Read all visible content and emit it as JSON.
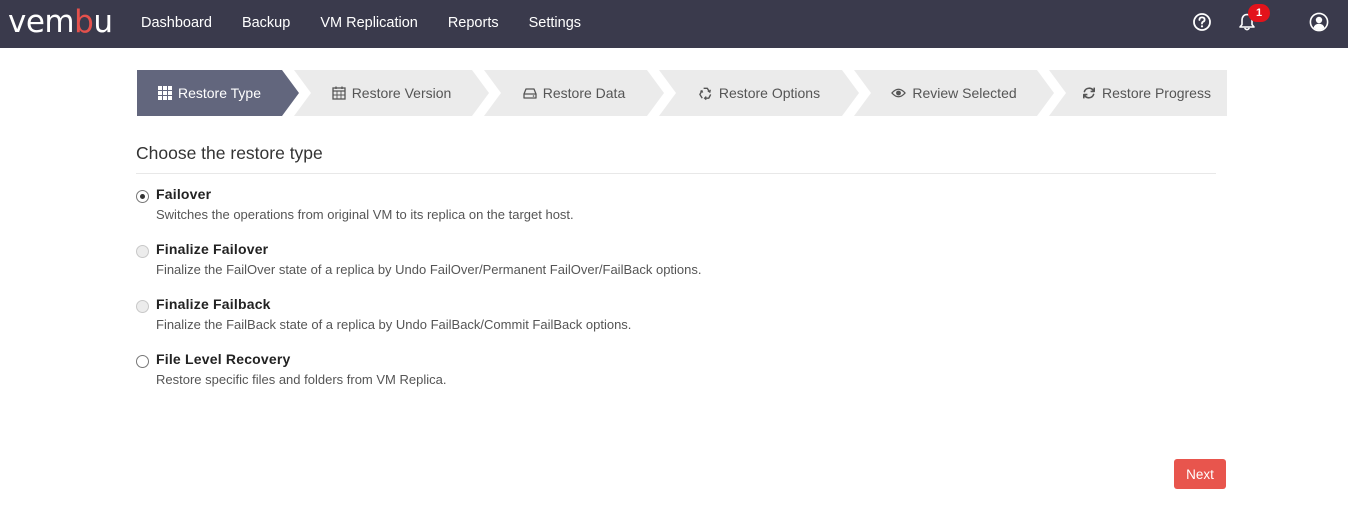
{
  "logo": {
    "text_main": "vem",
    "text_accent": "b",
    "text_end": "u"
  },
  "nav": [
    "Dashboard",
    "Backup",
    "VM Replication",
    "Reports",
    "Settings"
  ],
  "notifications": {
    "count": "1"
  },
  "steps": [
    {
      "label": "Restore Type",
      "icon": "grid-icon",
      "active": true
    },
    {
      "label": "Restore Version",
      "icon": "calendar-icon",
      "active": false
    },
    {
      "label": "Restore Data",
      "icon": "drive-icon",
      "active": false
    },
    {
      "label": "Restore Options",
      "icon": "recycle-icon",
      "active": false
    },
    {
      "label": "Review Selected",
      "icon": "eye-icon",
      "active": false
    },
    {
      "label": "Restore Progress",
      "icon": "refresh-icon",
      "active": false
    }
  ],
  "heading": "Choose the restore type",
  "options": [
    {
      "title": "Failover",
      "description": "Switches the operations from original VM to its replica on the target host.",
      "state": "checked"
    },
    {
      "title": "Finalize Failover",
      "description": "Finalize the FailOver state of a replica by Undo FailOver/Permanent FailOver/FailBack options.",
      "state": "disabled"
    },
    {
      "title": "Finalize Failback",
      "description": "Finalize the FailBack state of a replica by Undo FailBack/Commit FailBack options.",
      "state": "disabled"
    },
    {
      "title": "File Level Recovery",
      "description": "Restore specific files and folders from VM Replica.",
      "state": "unchecked"
    }
  ],
  "next_label": "Next",
  "colors": {
    "topbar": "#3a3a4c",
    "accent": "#e5514c",
    "active_step": "#62667d",
    "inactive_step": "#ebebeb"
  }
}
